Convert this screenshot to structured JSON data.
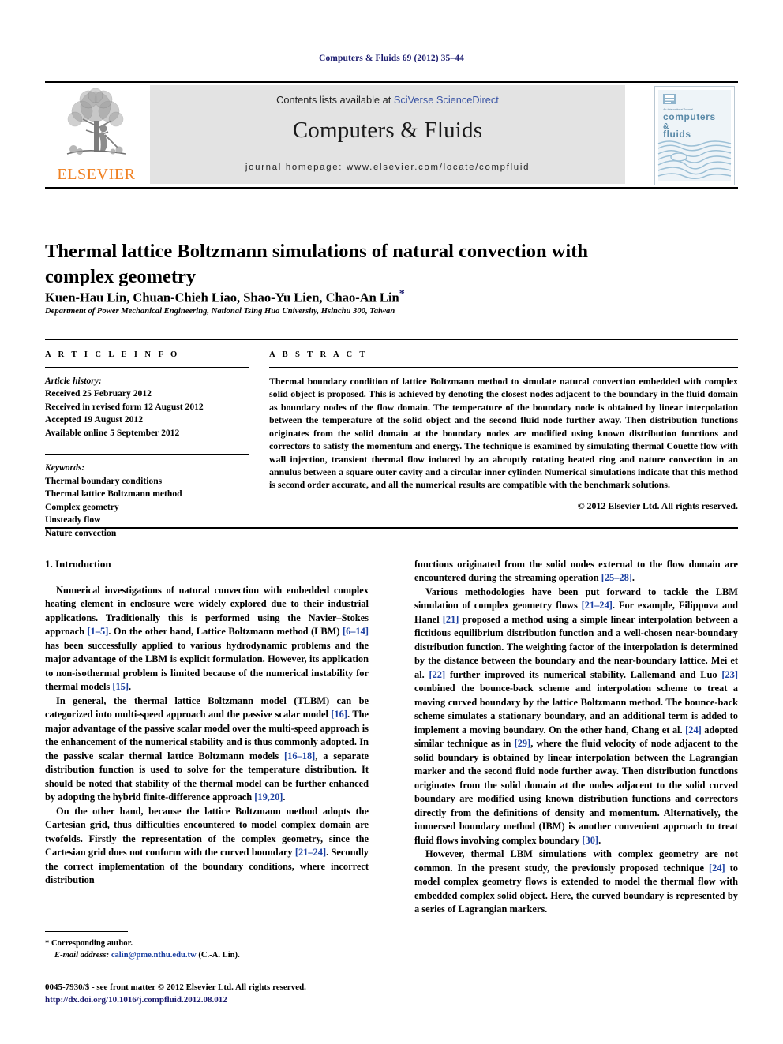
{
  "running_head": "Computers & Fluids 69 (2012) 35–44",
  "masthead": {
    "contents_prefix": "Contents lists available at ",
    "contents_link": "SciVerse ScienceDirect",
    "journal_title": "Computers & Fluids",
    "homepage": "journal homepage: www.elsevier.com/locate/compfluid",
    "publisher_wordmark": "ELSEVIER",
    "cover": {
      "kicker": "An International Journal",
      "line1": "computers",
      "line2": "&",
      "line3": "fluids"
    }
  },
  "article": {
    "title": "Thermal lattice Boltzmann simulations of natural convection with complex geometry",
    "authors": "Kuen-Hau Lin, Chuan-Chieh Liao, Shao-Yu Lien, Chao-An Lin",
    "corresponding_marker": "*",
    "affiliation": "Department of Power Mechanical Engineering, National Tsing Hua University, Hsinchu 300, Taiwan"
  },
  "article_info": {
    "heading": "A R T I C L E   I N F O",
    "history_label": "Article history:",
    "history": [
      "Received 25 February 2012",
      "Received in revised form 12 August 2012",
      "Accepted 19 August 2012",
      "Available online 5 September 2012"
    ],
    "keywords_label": "Keywords:",
    "keywords": [
      "Thermal boundary conditions",
      "Thermal lattice Boltzmann method",
      "Complex geometry",
      "Unsteady flow",
      "Nature convection"
    ]
  },
  "abstract": {
    "heading": "A B S T R A C T",
    "text": "Thermal boundary condition of lattice Boltzmann method to simulate natural convection embedded with complex solid object is proposed. This is achieved by denoting the closest nodes adjacent to the boundary in the fluid domain as boundary nodes of the flow domain. The temperature of the boundary node is obtained by linear interpolation between the temperature of the solid object and the second fluid node further away. Then distribution functions originates from the solid domain at the boundary nodes are modified using known distribution functions and correctors to satisfy the momentum and energy. The technique is examined by simulating thermal Couette flow with wall injection, transient thermal flow induced by an abruptly rotating heated ring and nature convection in an annulus between a square outer cavity and a circular inner cylinder. Numerical simulations indicate that this method is second order accurate, and all the numerical results are compatible with the benchmark solutions.",
    "copyright": "© 2012 Elsevier Ltd. All rights reserved."
  },
  "body": {
    "section_title": "1. Introduction",
    "left_paragraphs": [
      {
        "parts": [
          {
            "t": "Numerical investigations of natural convection with embedded complex heating element in enclosure were widely explored due to their industrial applications. Traditionally this is performed using the Navier–Stokes approach "
          },
          {
            "t": "[1–5]",
            "cite": true
          },
          {
            "t": ". On the other hand, Lattice Boltzmann method (LBM) "
          },
          {
            "t": "[6–14]",
            "cite": true
          },
          {
            "t": " has been successfully applied to various hydrodynamic problems and the major advantage of the LBM is explicit formulation. However, its application to non-isothermal problem is limited because of the numerical instability for thermal models "
          },
          {
            "t": "[15]",
            "cite": true
          },
          {
            "t": "."
          }
        ]
      },
      {
        "parts": [
          {
            "t": "In general, the thermal lattice Boltzmann model (TLBM) can be categorized into multi-speed approach and the passive scalar model "
          },
          {
            "t": "[16]",
            "cite": true
          },
          {
            "t": ". The major advantage of the passive scalar model over the multi-speed approach is the enhancement of the numerical stability and is thus commonly adopted. In the passive scalar thermal lattice Boltzmann models "
          },
          {
            "t": "[16–18]",
            "cite": true
          },
          {
            "t": ", a separate distribution function is used to solve for the temperature distribution. It should be noted that stability of the thermal model can be further enhanced by adopting the hybrid finite-difference approach "
          },
          {
            "t": "[19,20]",
            "cite": true
          },
          {
            "t": "."
          }
        ]
      },
      {
        "parts": [
          {
            "t": "On the other hand, because the lattice Boltzmann method adopts the Cartesian grid, thus difficulties encountered to model complex domain are twofolds. Firstly the representation of the complex geometry, since the Cartesian grid does not conform with the curved boundary "
          },
          {
            "t": "[21–24]",
            "cite": true
          },
          {
            "t": ". Secondly the correct implementation of the boundary conditions, where incorrect distribution"
          }
        ]
      }
    ],
    "right_paragraphs": [
      {
        "noindent": true,
        "parts": [
          {
            "t": "functions originated from the solid nodes external to the flow domain are encountered during the streaming operation "
          },
          {
            "t": "[25–28]",
            "cite": true
          },
          {
            "t": "."
          }
        ]
      },
      {
        "parts": [
          {
            "t": "Various methodologies have been put forward to tackle the LBM simulation of complex geometry flows "
          },
          {
            "t": "[21–24]",
            "cite": true
          },
          {
            "t": ". For example, Filippova and Hanel "
          },
          {
            "t": "[21]",
            "cite": true
          },
          {
            "t": " proposed a method using a simple linear interpolation between a fictitious equilibrium distribution function and a well-chosen near-boundary distribution function. The weighting factor of the interpolation is determined by the distance between the boundary and the near-boundary lattice. Mei et al. "
          },
          {
            "t": "[22]",
            "cite": true
          },
          {
            "t": " further improved its numerical stability. Lallemand and Luo "
          },
          {
            "t": "[23]",
            "cite": true
          },
          {
            "t": " combined the bounce-back scheme and interpolation scheme to treat a moving curved boundary by the lattice Boltzmann method. The bounce-back scheme simulates a stationary boundary, and an additional term is added to implement a moving boundary. On the other hand, Chang et al. "
          },
          {
            "t": "[24]",
            "cite": true
          },
          {
            "t": " adopted similar technique as in "
          },
          {
            "t": "[29]",
            "cite": true
          },
          {
            "t": ", where the fluid velocity of node adjacent to the solid boundary is obtained by linear interpolation between the Lagrangian marker and the second fluid node further away. Then distribution functions originates from the solid domain at the nodes adjacent to the solid curved boundary are modified using known distribution functions and correctors directly from the definitions of density and momentum. Alternatively, the immersed boundary method (IBM) is another convenient approach to treat fluid flows involving complex boundary "
          },
          {
            "t": "[30]",
            "cite": true
          },
          {
            "t": "."
          }
        ]
      },
      {
        "parts": [
          {
            "t": "However, thermal LBM simulations with complex geometry are not common. In the present study, the previously proposed technique "
          },
          {
            "t": "[24]",
            "cite": true
          },
          {
            "t": " to model complex geometry flows is extended to model the thermal flow with embedded complex solid object. Here, the curved boundary is represented by a series of Lagrangian markers."
          }
        ]
      }
    ]
  },
  "footnote": {
    "marker": "*",
    "corresponding": "Corresponding author.",
    "email_label": "E-mail address:",
    "email": "calin@pme.nthu.edu.tw",
    "email_suffix": "(C.-A. Lin)."
  },
  "footer": {
    "issn_line": "0045-7930/$ - see front matter © 2012 Elsevier Ltd. All rights reserved.",
    "doi": "http://dx.doi.org/10.1016/j.compfluid.2012.08.012"
  },
  "colors": {
    "running_head": "#1b1b6f",
    "link_blue": "#3a54a4",
    "citation_blue": "#1b3fa0",
    "elsevier_orange": "#f08122",
    "panel_gray": "#e3e3e3"
  }
}
